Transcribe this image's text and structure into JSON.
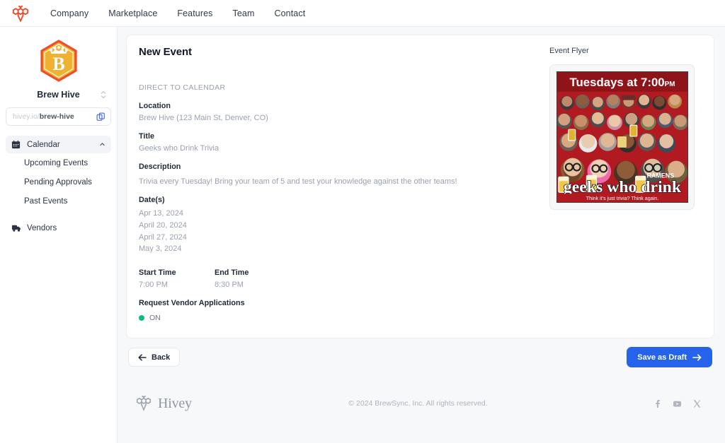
{
  "topnav": {
    "logo_icon": "bee-logo-icon",
    "links": [
      {
        "label": "Company"
      },
      {
        "label": "Marketplace"
      },
      {
        "label": "Features"
      },
      {
        "label": "Team"
      },
      {
        "label": "Contact"
      }
    ]
  },
  "sidebar": {
    "org_logo_letter": "B",
    "org_name": "Brew Hive",
    "switcher_icon": "chevron-up-down-icon",
    "url": {
      "prefix": "hivey.io/",
      "slug": "brew-hive",
      "copy_icon": "copy-icon"
    },
    "nav": [
      {
        "label": "Calendar",
        "icon": "calendar-icon",
        "expanded_icon": "chevron-up-icon",
        "active": true,
        "children": [
          {
            "label": "Upcoming Events"
          },
          {
            "label": "Pending Approvals"
          },
          {
            "label": "Past Events"
          }
        ]
      },
      {
        "label": "Vendors",
        "icon": "truck-icon",
        "active": false,
        "children": []
      }
    ]
  },
  "main": {
    "page_title": "New Event",
    "section_label": "DIRECT TO CALENDAR",
    "fields": {
      "location": {
        "label": "Location",
        "value": "Brew Hive (123 Main St, Denver, CO)"
      },
      "title": {
        "label": "Title",
        "value": "Geeks who Drink Trivia"
      },
      "description": {
        "label": "Description",
        "value": "Trivia every Tuesday! Bring your team of 5 and test your knowledge against the other teams!"
      },
      "dates": {
        "label": "Date(s)",
        "values": [
          "Apr 13, 2024",
          "April 20, 2024",
          "April 27, 2024",
          "May 3, 2024"
        ]
      },
      "start_time": {
        "label": "Start Time",
        "value": "7:00 PM"
      },
      "end_time": {
        "label": "End Time",
        "value": "8:30 PM"
      },
      "vendor_applications": {
        "label": "Request Vendor Applications",
        "state": "ON",
        "state_color": "#10b981"
      }
    },
    "flyer": {
      "label": "Event Flyer",
      "headline": "Tuesdays at 7:00",
      "headline_suffix": "PM",
      "brand": "geeks who drink",
      "tagline": "Think it's just trivia?  Think again.",
      "sponsor": "RAMENS",
      "bg_color": "#b01a20"
    }
  },
  "actions": {
    "back": {
      "label": "Back",
      "icon": "arrow-left-icon"
    },
    "save_draft": {
      "label": "Save as Draft",
      "icon": "arrow-right-icon",
      "color": "#2563eb"
    }
  },
  "footer": {
    "brand_icon": "bee-logo-icon",
    "brand_name": "Hivey",
    "copyright": "© 2024 BrewSync, Inc. All rights reserved.",
    "social": [
      {
        "name": "facebook-icon"
      },
      {
        "name": "youtube-icon"
      },
      {
        "name": "x-twitter-icon"
      }
    ]
  }
}
